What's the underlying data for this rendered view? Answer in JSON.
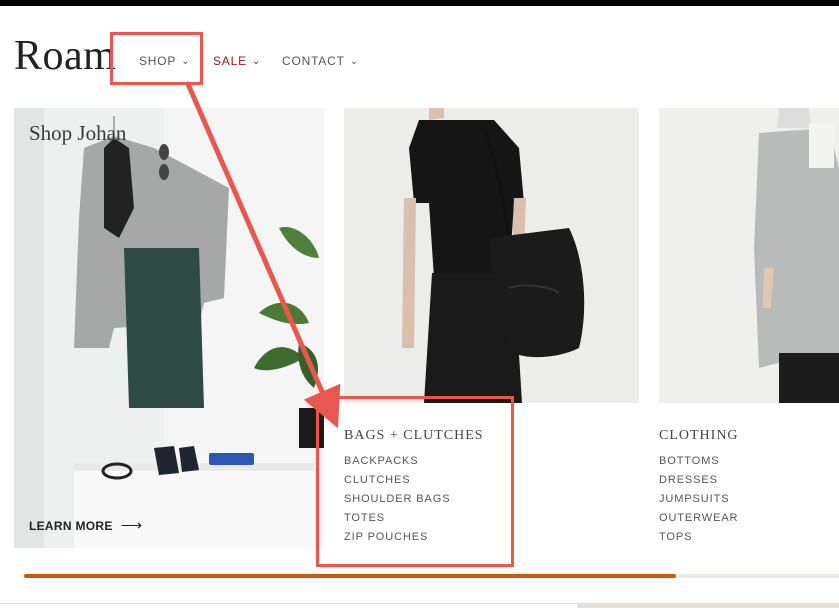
{
  "header": {
    "logo": "Roam",
    "nav": [
      {
        "label": "SHOP"
      },
      {
        "label": "SALE"
      },
      {
        "label": "CONTACT"
      }
    ]
  },
  "feature": {
    "title": "Shop Johan",
    "cta": "LEARN MORE"
  },
  "menu": {
    "categories": [
      {
        "title": "BAGS + CLUTCHES",
        "items": [
          "BACKPACKS",
          "CLUTCHES",
          "SHOULDER BAGS",
          "TOTES",
          "ZIP POUCHES"
        ]
      },
      {
        "title": "CLOTHING",
        "items": [
          "BOTTOMS",
          "DRESSES",
          "JUMPSUITS",
          "OUTERWEAR",
          "TOPS"
        ]
      }
    ]
  },
  "carousel": {
    "progress": 0.8
  },
  "colors": {
    "annotation": "#e8584f",
    "sale": "#8b1a1a",
    "progress": "#c25a10"
  }
}
